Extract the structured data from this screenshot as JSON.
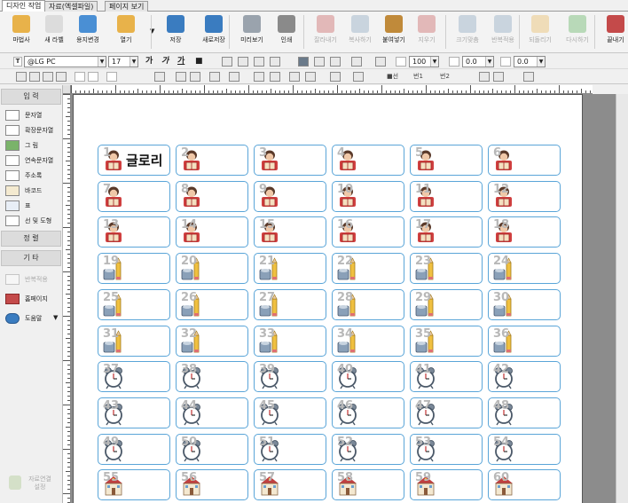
{
  "tabs": [
    "디자인 작업",
    "자료(엑셀파일)",
    "페이지 보기"
  ],
  "ribbon": {
    "buttons": [
      {
        "label": "마법사",
        "icon": "wand-icon",
        "color": "#e8b24a",
        "enabled": true
      },
      {
        "label": "새 라벨",
        "icon": "new-label-icon",
        "color": "#dcdcdc",
        "enabled": true
      },
      {
        "label": "용지변경",
        "icon": "paper-change-icon",
        "color": "#4a8fd4",
        "enabled": true
      },
      {
        "label": "열기",
        "icon": "folder-open-icon",
        "color": "#e8b24a",
        "enabled": true
      },
      {
        "label": "저장",
        "icon": "save-icon",
        "color": "#3a7cc0",
        "enabled": true
      },
      {
        "label": "새로저장",
        "icon": "save-as-icon",
        "color": "#3a7cc0",
        "enabled": true
      },
      {
        "label": "미리보기",
        "icon": "preview-icon",
        "color": "#9aa3ad",
        "enabled": true
      },
      {
        "label": "인쇄",
        "icon": "print-icon",
        "color": "#8a8a8a",
        "enabled": true
      },
      {
        "label": "잘라내기",
        "icon": "cut-icon",
        "color": "#c44a4a",
        "enabled": false
      },
      {
        "label": "복사하기",
        "icon": "copy-icon",
        "color": "#7a9ab8",
        "enabled": false
      },
      {
        "label": "붙여넣기",
        "icon": "paste-icon",
        "color": "#c08a3a",
        "enabled": true
      },
      {
        "label": "지우기",
        "icon": "delete-icon",
        "color": "#c44a4a",
        "enabled": false
      },
      {
        "label": "크기맞춤",
        "icon": "fit-size-icon",
        "color": "#7a9ab8",
        "enabled": false
      },
      {
        "label": "반복적용",
        "icon": "repeat-apply-icon",
        "color": "#7a9ab8",
        "enabled": false
      },
      {
        "label": "되돌리기",
        "icon": "undo-icon",
        "color": "#e8b24a",
        "enabled": false
      },
      {
        "label": "다시하기",
        "icon": "redo-icon",
        "color": "#4aa84a",
        "enabled": false
      },
      {
        "label": "끝내기",
        "icon": "exit-icon",
        "color": "#c44a4a",
        "enabled": true
      }
    ]
  },
  "format": {
    "font_name": "@LG PC",
    "font_size": "17",
    "bold_labels": [
      "가",
      "가",
      "가",
      "■"
    ],
    "line_spacing": "100",
    "char_spacing": "0.0",
    "word_spacing": "0.0"
  },
  "drawbar": {
    "label1": "■선",
    "label2": "번1",
    "label3": "번2"
  },
  "leftpanel": {
    "section_input": "입 력",
    "items": [
      {
        "label": "문자열",
        "icon": "text-icon"
      },
      {
        "label": "확장문자열",
        "icon": "ext-text-icon"
      },
      {
        "label": "그 림",
        "icon": "image-icon"
      },
      {
        "label": "연속문자열",
        "icon": "serial-text-icon"
      },
      {
        "label": "주소록",
        "icon": "address-icon"
      },
      {
        "label": "바코드",
        "icon": "barcode-icon"
      },
      {
        "label": "표",
        "icon": "table-icon"
      },
      {
        "label": "선 및 도형",
        "icon": "shapes-icon"
      }
    ],
    "section_edit": "정 렬",
    "section_other": "기 타",
    "other_items": [
      {
        "label": "반복적용",
        "icon": "repeat-icon"
      },
      {
        "label": "홈페이지",
        "icon": "home-icon"
      },
      {
        "label": "도움말",
        "icon": "help-icon"
      }
    ],
    "footer": "자료연결 설정"
  },
  "labels": {
    "first_text": "글로리",
    "numbers": [
      "1",
      "2",
      "3",
      "4",
      "5",
      "6",
      "7",
      "8",
      "9",
      "10",
      "11",
      "12",
      "13",
      "14",
      "15",
      "16",
      "17",
      "18",
      "19",
      "20",
      "21",
      "22",
      "23",
      "24",
      "25",
      "26",
      "27",
      "28",
      "29",
      "30",
      "31",
      "32",
      "33",
      "34",
      "35",
      "36",
      "37",
      "38",
      "39",
      "40",
      "41",
      "42",
      "43",
      "44",
      "45",
      "46",
      "47",
      "48",
      "49",
      "50",
      "51",
      "52",
      "53",
      "54",
      "55",
      "56",
      "57",
      "58",
      "59",
      "60"
    ],
    "icon_rows": [
      "reader",
      "reader",
      "reader",
      "stationery",
      "stationery",
      "stationery",
      "alarm-clock",
      "alarm-clock",
      "alarm-clock",
      "school"
    ]
  }
}
